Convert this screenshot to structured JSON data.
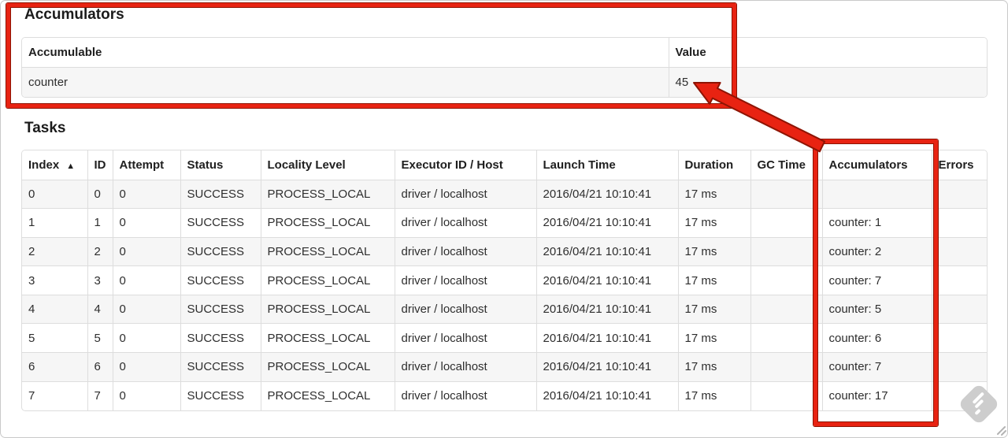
{
  "accumulators": {
    "heading": "Accumulators",
    "columns": [
      "Accumulable",
      "Value"
    ],
    "rows": [
      [
        "counter",
        "45"
      ]
    ]
  },
  "tasks": {
    "heading": "Tasks",
    "sort_indicator": "▲",
    "sorted_column": "Index",
    "columns": [
      "Index",
      "ID",
      "Attempt",
      "Status",
      "Locality Level",
      "Executor ID / Host",
      "Launch Time",
      "Duration",
      "GC Time",
      "Accumulators",
      "Errors"
    ],
    "rows": [
      [
        "0",
        "0",
        "0",
        "SUCCESS",
        "PROCESS_LOCAL",
        "driver / localhost",
        "2016/04/21 10:10:41",
        "17 ms",
        "",
        "",
        ""
      ],
      [
        "1",
        "1",
        "0",
        "SUCCESS",
        "PROCESS_LOCAL",
        "driver / localhost",
        "2016/04/21 10:10:41",
        "17 ms",
        "",
        "counter: 1",
        ""
      ],
      [
        "2",
        "2",
        "0",
        "SUCCESS",
        "PROCESS_LOCAL",
        "driver / localhost",
        "2016/04/21 10:10:41",
        "17 ms",
        "",
        "counter: 2",
        ""
      ],
      [
        "3",
        "3",
        "0",
        "SUCCESS",
        "PROCESS_LOCAL",
        "driver / localhost",
        "2016/04/21 10:10:41",
        "17 ms",
        "",
        "counter: 7",
        ""
      ],
      [
        "4",
        "4",
        "0",
        "SUCCESS",
        "PROCESS_LOCAL",
        "driver / localhost",
        "2016/04/21 10:10:41",
        "17 ms",
        "",
        "counter: 5",
        ""
      ],
      [
        "5",
        "5",
        "0",
        "SUCCESS",
        "PROCESS_LOCAL",
        "driver / localhost",
        "2016/04/21 10:10:41",
        "17 ms",
        "",
        "counter: 6",
        ""
      ],
      [
        "6",
        "6",
        "0",
        "SUCCESS",
        "PROCESS_LOCAL",
        "driver / localhost",
        "2016/04/21 10:10:41",
        "17 ms",
        "",
        "counter: 7",
        ""
      ],
      [
        "7",
        "7",
        "0",
        "SUCCESS",
        "PROCESS_LOCAL",
        "driver / localhost",
        "2016/04/21 10:10:41",
        "17 ms",
        "",
        "counter: 17",
        ""
      ]
    ]
  },
  "annotations": {
    "highlighted_value": "45",
    "colors": {
      "annotation_red": "#e82312",
      "annotation_red_dark": "#8e1404",
      "stripe_gray": "#f6f6f6",
      "table_border_gray": "#dddddd"
    }
  },
  "icons": {
    "watermark": "diamond-stripes-watermark",
    "sort": "triangle-up"
  }
}
